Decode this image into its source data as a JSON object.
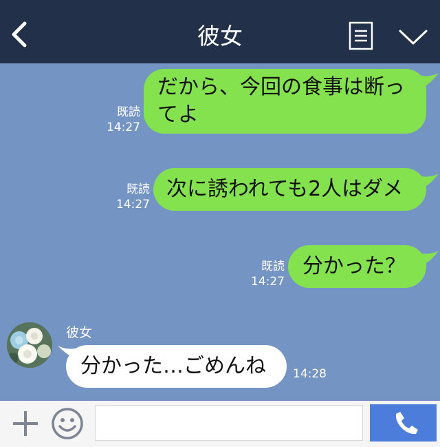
{
  "header": {
    "title": "彼女",
    "colors": {
      "background": "#23304a"
    }
  },
  "messages": [
    {
      "side": "right",
      "lines": [
        "だから、今回の食事は断っ",
        "てよ"
      ],
      "read_label": "既読",
      "time": "14:27"
    },
    {
      "side": "right",
      "lines": [
        "次に誘われても2人はダメ"
      ],
      "read_label": "既読",
      "time": "14:27"
    },
    {
      "side": "right",
      "lines": [
        "分かった？"
      ],
      "read_label": "既読",
      "time": "14:27"
    },
    {
      "side": "left",
      "sender": "彼女",
      "lines": [
        "分かった…ごめんね"
      ],
      "time": "14:28"
    }
  ],
  "footer": {
    "input_value": "",
    "input_placeholder": "",
    "icons": [
      "plus-icon",
      "smile-icon",
      "phone-icon"
    ]
  },
  "colors": {
    "chat_background": "#7494c4",
    "sent_bubble": "#84e24e",
    "received_bubble": "#ffffff",
    "call_button": "#4c7ddb"
  }
}
